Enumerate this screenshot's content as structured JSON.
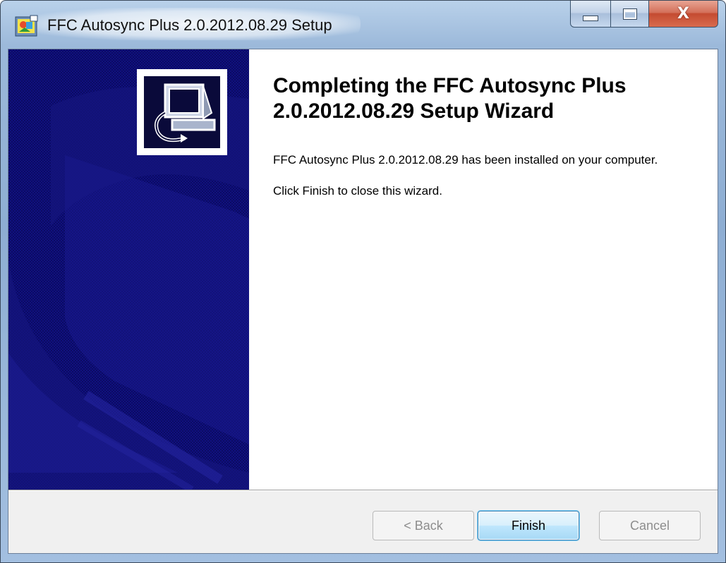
{
  "window": {
    "title": "FFC Autosync Plus 2.0.2012.08.29 Setup"
  },
  "caption": {
    "minimize_icon": "minimize-icon",
    "maximize_icon": "maximize-icon",
    "close_icon": "close-icon",
    "close_glyph": "X"
  },
  "page": {
    "heading": "Completing the FFC Autosync Plus 2.0.2012.08.29 Setup Wizard",
    "installed_message": "FFC Autosync Plus 2.0.2012.08.29 has been installed on your computer.",
    "finish_instruction": "Click Finish to close this wizard."
  },
  "buttons": {
    "back": "< Back",
    "finish": "Finish",
    "cancel": "Cancel",
    "back_enabled": false,
    "cancel_enabled": false,
    "default": "finish"
  },
  "colors": {
    "banner": "#0a0a5a",
    "accent": "#3c7fb1",
    "close_button": "#c44b31"
  }
}
